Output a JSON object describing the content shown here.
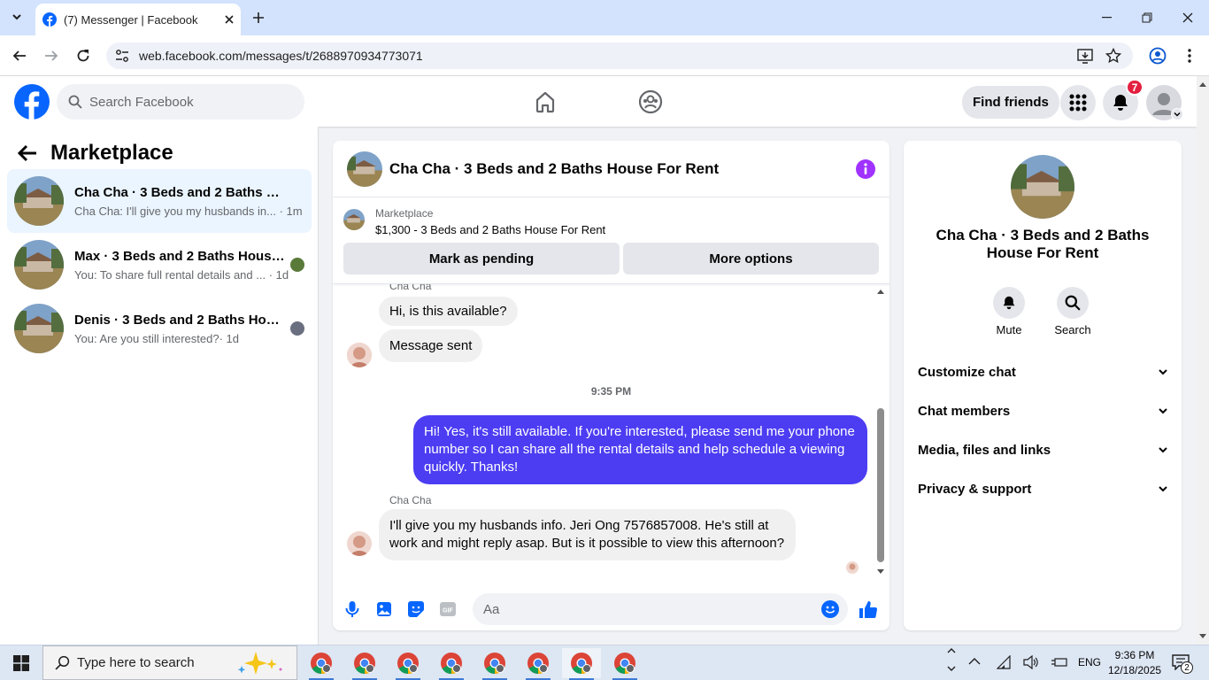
{
  "browser": {
    "tab_title": "(7) Messenger | Facebook",
    "url": "web.facebook.com/messages/t/2688970934773071"
  },
  "header": {
    "search_placeholder": "Search Facebook",
    "find_friends": "Find friends",
    "notification_count": "7"
  },
  "sidebar": {
    "title": "Marketplace",
    "conversations": [
      {
        "title": "Cha Cha · 3 Beds and 2 Baths Hou...",
        "preview": "Cha Cha: I'll give you my husbands in...",
        "time": "· 1m"
      },
      {
        "title": "Max · 3 Beds and 2 Baths House...",
        "preview": "You: To share full rental details and ...",
        "time": "· 1d"
      },
      {
        "title": "Denis · 3 Beds and 2 Baths Hous...",
        "preview": "You: Are you still interested?",
        "time": "· 1d"
      }
    ]
  },
  "chat": {
    "title": "Cha Cha · 3 Beds and 2 Baths House For Rent",
    "listing_source": "Marketplace",
    "listing_price": "$1,300 - 3 Beds and 2 Baths House For Rent",
    "mark_pending": "Mark as pending",
    "more_options": "More options",
    "sender_name": "Cha Cha",
    "msg1": "Hi, is this available?",
    "msg2": "Message sent",
    "timestamp": "9:35 PM",
    "msg3": "Hi! Yes, it's still available. If you're interested, please send me your phone number so I can share all the rental details and help schedule a viewing quickly. Thanks!",
    "sender_name2": "Cha Cha",
    "msg4": "I'll give you my husbands info. Jeri Ong 7576857008. He's still at work and might reply asap. But is it possible to view this afternoon?",
    "composer_placeholder": "Aa"
  },
  "info_panel": {
    "name": "Cha Cha · 3 Beds and 2 Baths House For Rent",
    "mute": "Mute",
    "search": "Search",
    "sections": [
      "Customize chat",
      "Chat members",
      "Media, files and links",
      "Privacy & support"
    ]
  },
  "taskbar": {
    "search_placeholder": "Type here to search",
    "lang": "ENG",
    "time": "9:36 PM",
    "date": "12/18/2025",
    "notif_count": "2"
  },
  "colors": {
    "fb_blue": "#0866ff",
    "outgoing_bubble": "#4c3df2",
    "accent_purple": "#a033ff",
    "badge_red": "#e41e3f"
  }
}
